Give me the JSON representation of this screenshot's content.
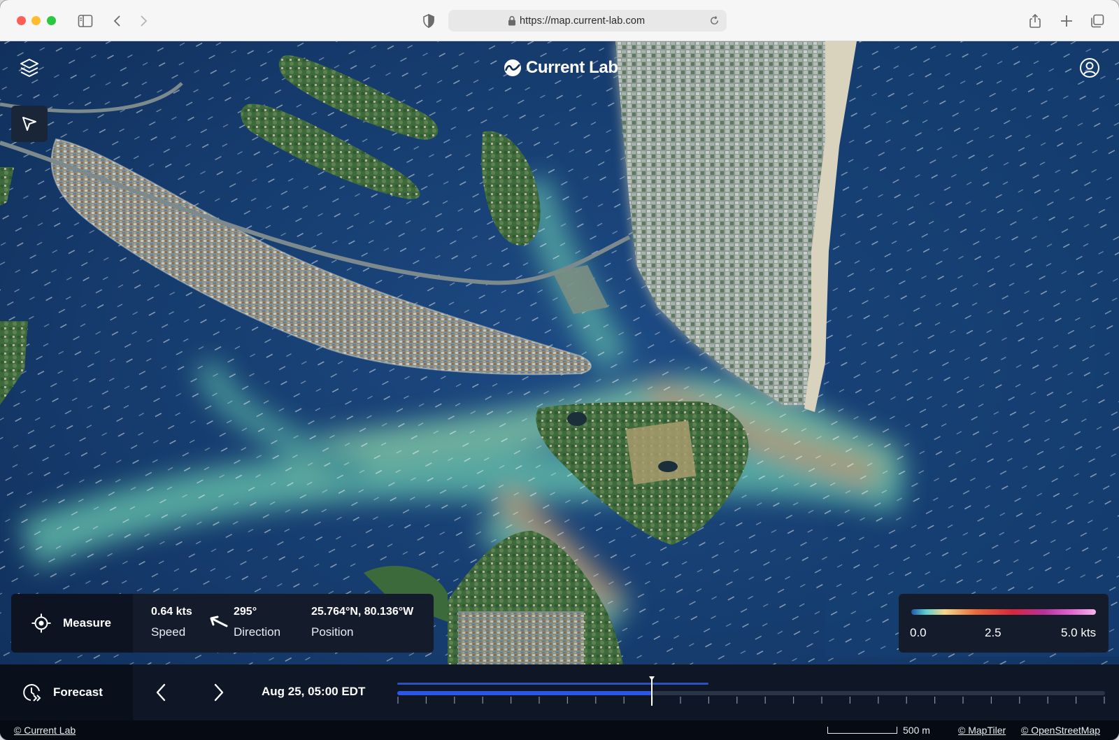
{
  "browser": {
    "url": "https://map.current-lab.com"
  },
  "app": {
    "brand": "Current Lab"
  },
  "measure": {
    "button_label": "Measure",
    "speed_value": "0.64 kts",
    "speed_label": "Speed",
    "direction_value": "295°",
    "direction_label": "Direction",
    "position_value": "25.764°N, 80.136°W",
    "position_label": "Position"
  },
  "legend": {
    "min": "0.0",
    "mid": "2.5",
    "max": "5.0 kts",
    "colors": [
      "#1d5aa8",
      "#5fd0d0",
      "#f5d78a",
      "#e86b3b",
      "#d7263d",
      "#b8329b",
      "#e46bd2",
      "#f7b4ee"
    ]
  },
  "timeline": {
    "forecast_label": "Forecast",
    "current_time": "Aug 25, 05:00 EDT",
    "progress_fraction": 0.36,
    "buffered_fraction": 0.44,
    "tick_count": 26
  },
  "attribution": {
    "current_lab": "© Current Lab",
    "scale_label": "500 m",
    "maptiler": "© MapTiler",
    "openstreetmap": "© OpenStreetMap"
  },
  "icons": {
    "layers": "layers-icon",
    "select": "cursor-arrow-icon",
    "account": "user-circle-icon",
    "measure": "crosshair-icon",
    "forecast": "forecast-clock-icon",
    "prev": "chevron-left-icon",
    "next": "chevron-right-icon"
  }
}
